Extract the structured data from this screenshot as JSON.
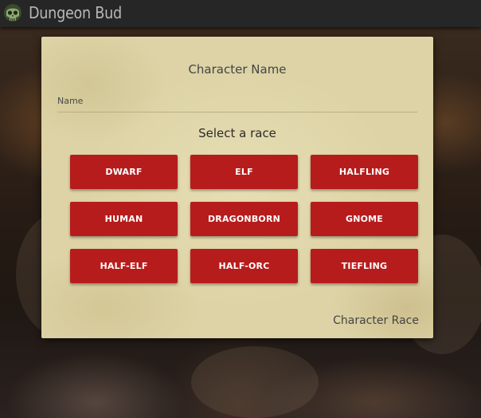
{
  "app": {
    "title": "Dungeon Bud",
    "logo_icon": "skull-icon"
  },
  "character_form": {
    "title": "Character Name",
    "name_field": {
      "placeholder": "Name",
      "value": ""
    },
    "race_heading": "Select a race",
    "races": [
      "DWARF",
      "ELF",
      "HALFLING",
      "HUMAN",
      "DRAGONBORN",
      "GNOME",
      "HALF-ELF",
      "HALF-ORC",
      "TIEFLING"
    ],
    "footer_label": "Character Race"
  },
  "colors": {
    "topbar": "#262626",
    "title_text": "#b8b8b8",
    "parchment": "#ddd3a6",
    "race_button": "#b71c1c",
    "race_button_text": "#ffffff"
  }
}
